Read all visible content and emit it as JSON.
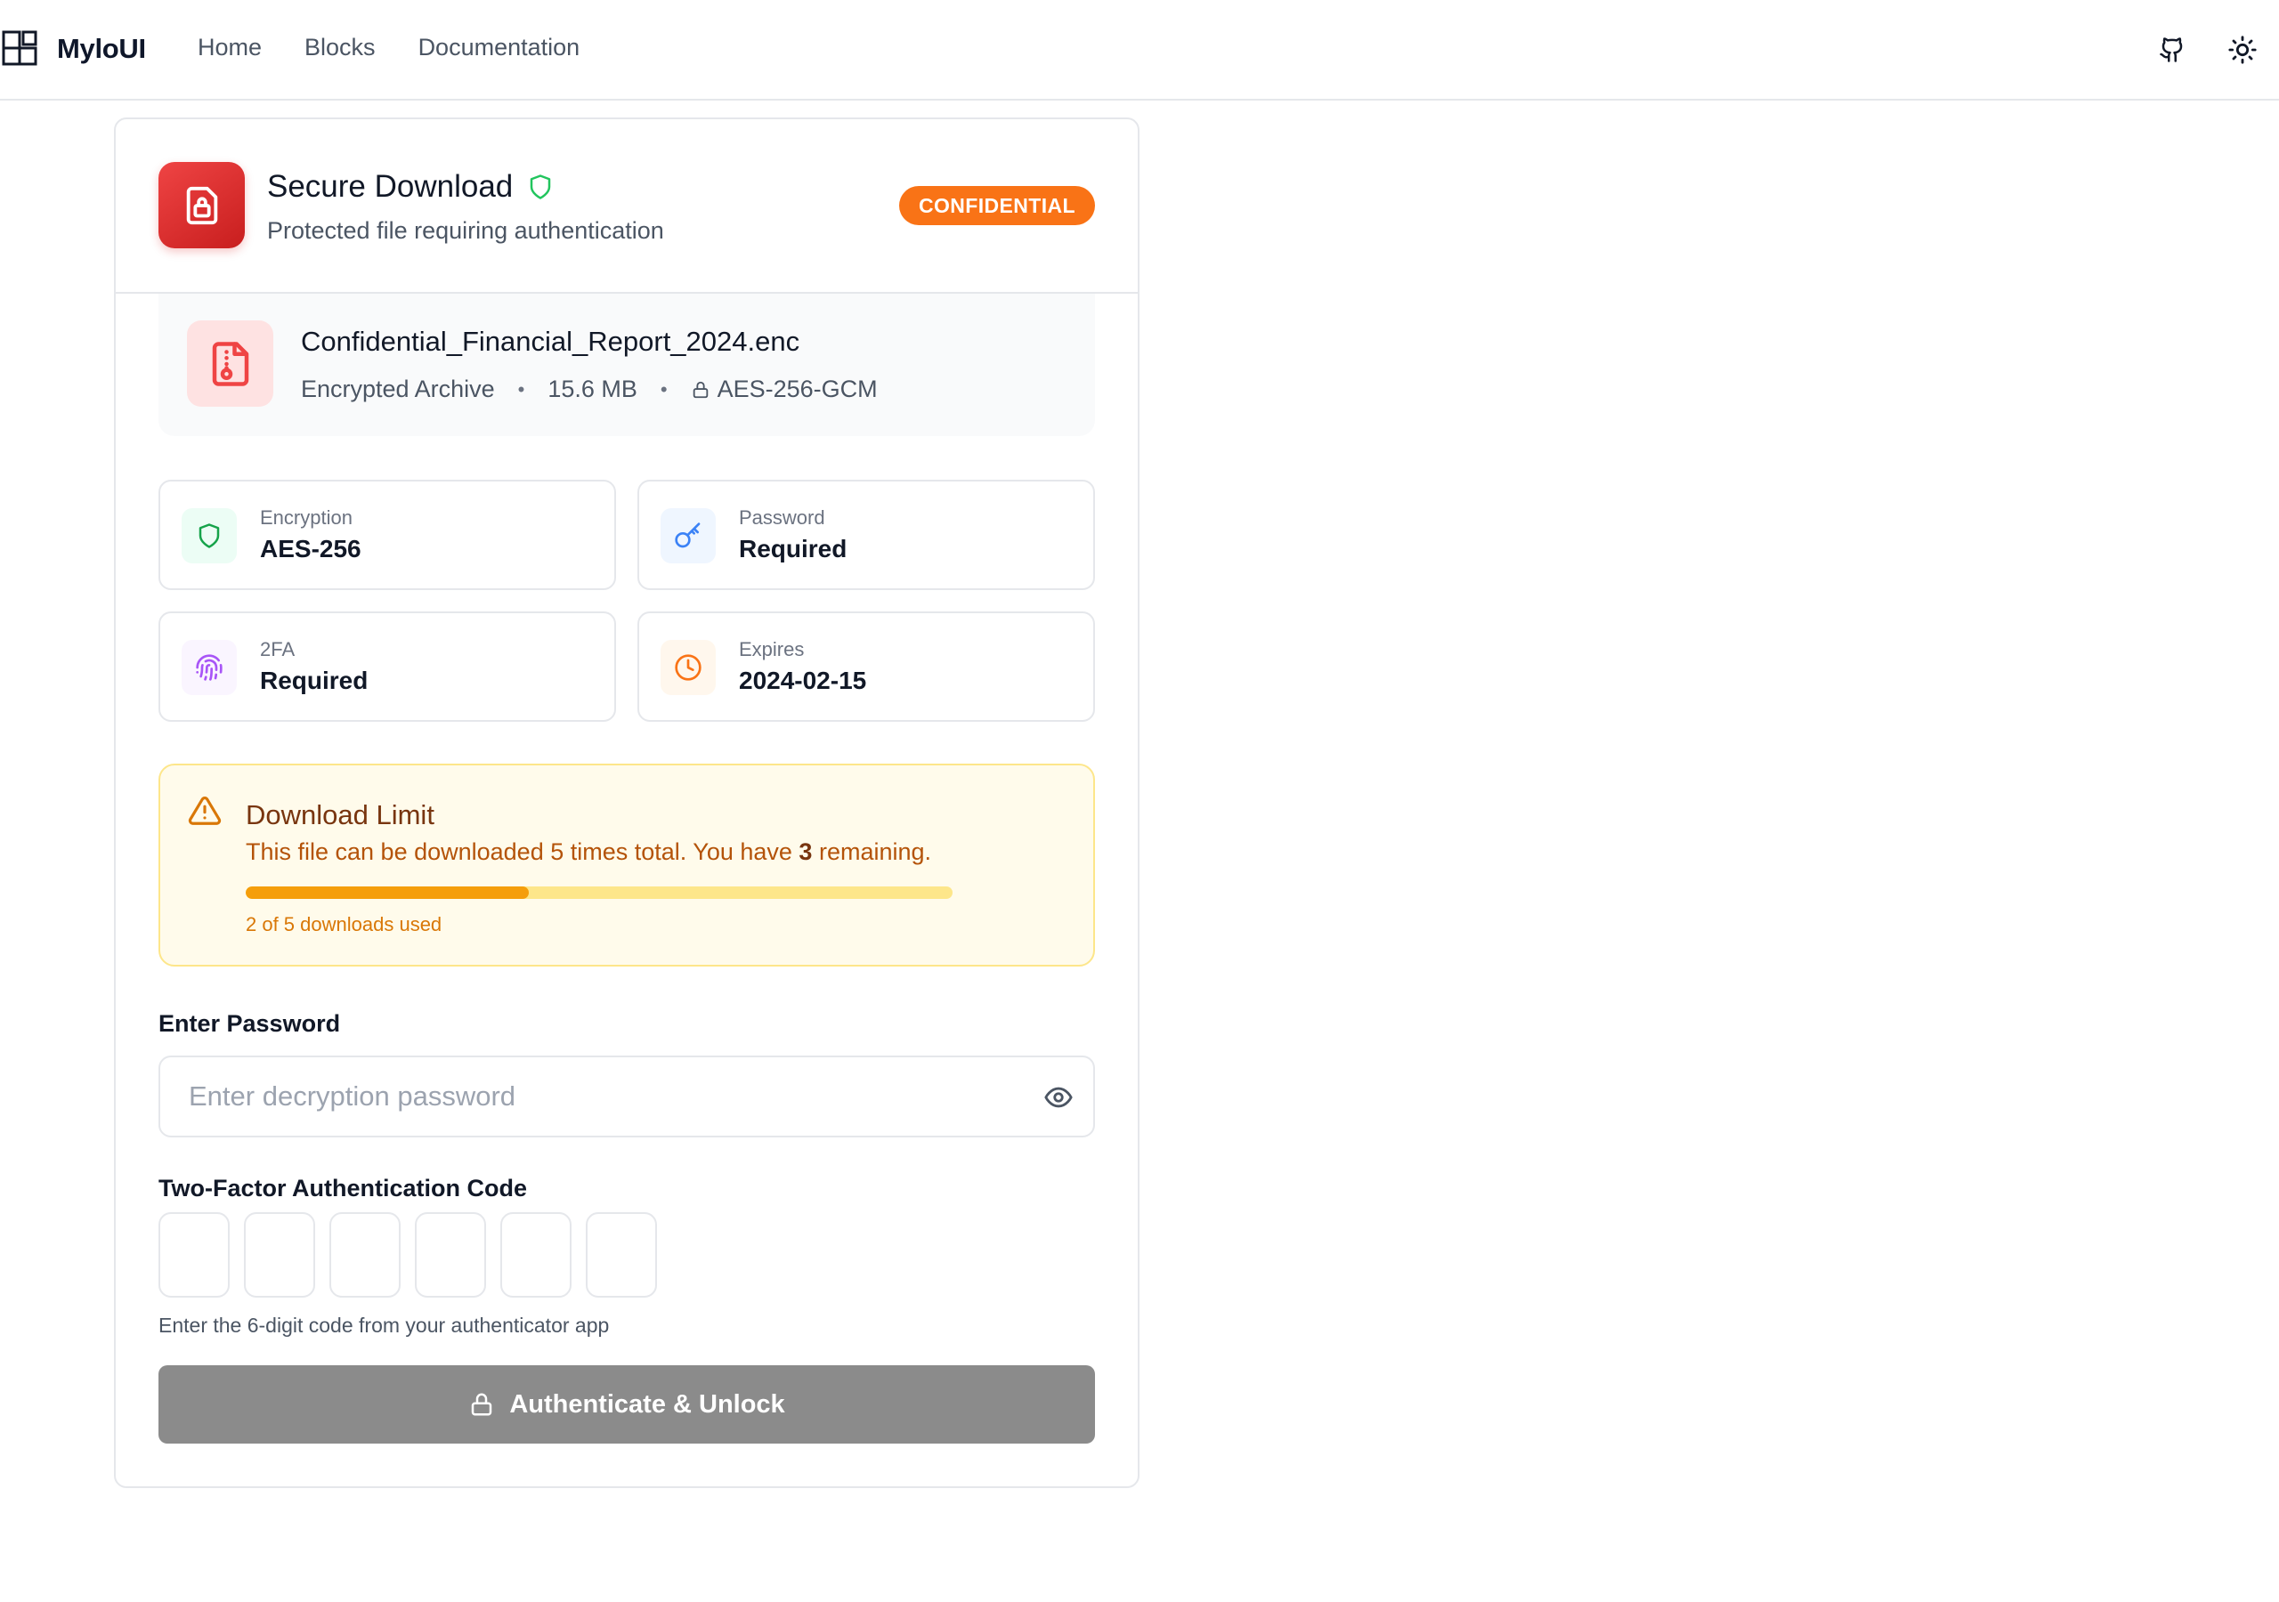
{
  "header": {
    "brand": "MyloUI",
    "nav": [
      {
        "label": "Home"
      },
      {
        "label": "Blocks"
      },
      {
        "label": "Documentation"
      }
    ]
  },
  "card": {
    "title": "Secure Download",
    "subtitle": "Protected file requiring authentication",
    "badge": "CONFIDENTIAL",
    "file": {
      "name": "Confidential_Financial_Report_2024.enc",
      "type": "Encrypted Archive",
      "size": "15.6 MB",
      "cipher": "AES-256-GCM"
    },
    "stats": [
      {
        "label": "Encryption",
        "value": "AES-256",
        "icon": "shield-icon",
        "color": "#16a34a"
      },
      {
        "label": "Password",
        "value": "Required",
        "icon": "key-icon",
        "color": "#3b82f6"
      },
      {
        "label": "2FA",
        "value": "Required",
        "icon": "fingerprint-icon",
        "color": "#a855f7"
      },
      {
        "label": "Expires",
        "value": "2024-02-15",
        "icon": "clock-icon",
        "color": "#f97316"
      }
    ],
    "limit": {
      "title": "Download Limit",
      "text_before": "This file can be downloaded 5 times total. You have ",
      "remaining": "3",
      "text_after": " remaining.",
      "used_fraction": 0.4,
      "used_text": "2 of 5 downloads used"
    },
    "password": {
      "label": "Enter Password",
      "placeholder": "Enter decryption password",
      "value": ""
    },
    "otp": {
      "label": "Two-Factor Authentication Code",
      "digits": [
        "",
        "",
        "",
        "",
        "",
        ""
      ],
      "hint": "Enter the 6-digit code from your authenticator app"
    },
    "submit_label": "Authenticate & Unlock"
  },
  "colors": {
    "accent_red": "#dc2626",
    "badge_orange": "#f97316",
    "warning_bg": "#fffbeb",
    "button_disabled": "#8b8b8b"
  }
}
